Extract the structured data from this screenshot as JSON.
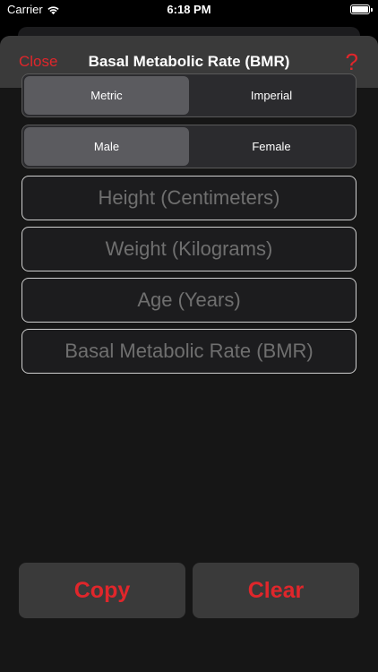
{
  "status_bar": {
    "carrier": "Carrier",
    "time": "6:18 PM"
  },
  "nav": {
    "close_label": "Close",
    "title": "Basal Metabolic Rate (BMR)",
    "help_label": "?"
  },
  "units": {
    "options": [
      "Metric",
      "Imperial"
    ],
    "selected": "Metric"
  },
  "gender": {
    "options": [
      "Male",
      "Female"
    ],
    "selected": "Male"
  },
  "fields": {
    "height_placeholder": "Height (Centimeters)",
    "weight_placeholder": "Weight (Kilograms)",
    "age_placeholder": "Age (Years)",
    "bmr_placeholder": "Basal Metabolic Rate (BMR)"
  },
  "actions": {
    "copy_label": "Copy",
    "clear_label": "Clear"
  },
  "colors": {
    "accent": "#e0262b",
    "background": "#161616",
    "nav_background": "#3a3a3a"
  }
}
